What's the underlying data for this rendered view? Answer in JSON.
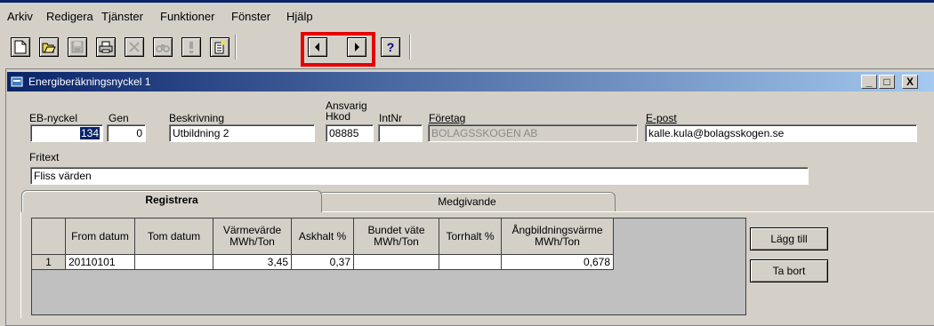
{
  "menu": [
    "Arkiv",
    "Redigera",
    "Tjänster",
    "Funktioner",
    "Fönster",
    "Hjälp"
  ],
  "toolbar": [
    "new-document-icon",
    "open-folder-icon",
    "save-icon",
    "print-icon",
    "delete-icon",
    "find-icon",
    "alert-icon",
    "new-record-icon",
    "previous-icon",
    "next-icon",
    "help-icon"
  ],
  "window": {
    "title": "Energiberäkningsnyckel 1",
    "min": "_",
    "max": "□",
    "close": "X"
  },
  "form": {
    "eb_label": "EB-nyckel",
    "eb_value": "134",
    "gen_label": "Gen",
    "gen_value": "0",
    "beskrivning_label": "Beskrivning",
    "beskrivning_value": "Utbildning 2",
    "ansvarig_label": "Ansvarig",
    "hkod_label": "Hkod",
    "hkod_value": "08885",
    "intnr_label": "IntNr",
    "intnr_value": "",
    "foretag_label": "Företag",
    "foretag_value": "BOLAGSSKOGEN AB",
    "epost_label": "E-post",
    "epost_value": "kalle.kula@bolagsskogen.se",
    "fritext_label": "Fritext",
    "fritext_value": "Fliss värden"
  },
  "tabs": {
    "registrera": "Registrera",
    "medgivande": "Medgivande"
  },
  "grid": {
    "columns": [
      {
        "l1": "From datum",
        "l2": ""
      },
      {
        "l1": "Tom datum",
        "l2": ""
      },
      {
        "l1": "Värmevärde",
        "l2": "MWh/Ton"
      },
      {
        "l1": "Askhalt %",
        "l2": ""
      },
      {
        "l1": "Bundet väte",
        "l2": "MWh/Ton"
      },
      {
        "l1": "Torrhalt %",
        "l2": ""
      },
      {
        "l1": "Ångbildningsvärme",
        "l2": "MWh/Ton"
      }
    ],
    "rows": [
      {
        "n": "1",
        "from": "20110101",
        "tom": "",
        "varme": "3,45",
        "askhalt": "0,37",
        "bundet": "",
        "torrhalt": "",
        "angbildning": "0,678"
      }
    ]
  },
  "buttons": {
    "add": "Lägg till",
    "remove": "Ta bort"
  },
  "colors": {
    "titlebar": "#0a246a",
    "highlight": "#e50000",
    "face": "#d4d0c8"
  }
}
